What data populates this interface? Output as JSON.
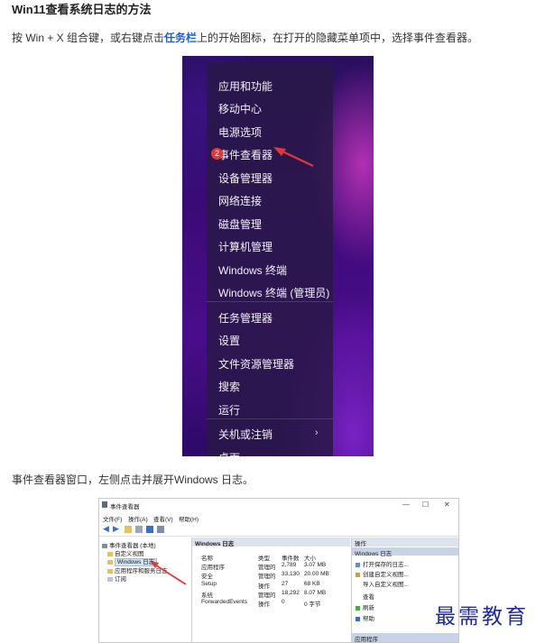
{
  "article": {
    "title": "Win11查看系统日志的方法",
    "p1_before": "按 Win + X 组合键，或右键点击",
    "p1_link": "任务栏",
    "p1_after": "上的开始图标，在打开的隐藏菜单项中，选择事件查看器。",
    "p2": "事件查看器窗口，左侧点击并展开Windows 日志。"
  },
  "winx_menu": {
    "badge": "2",
    "items": [
      "应用和功能",
      "移动中心",
      "电源选项",
      "事件查看器",
      "设备管理器",
      "网络连接",
      "磁盘管理",
      "计算机管理",
      "Windows 终端",
      "Windows 终端 (管理员)",
      "任务管理器",
      "设置",
      "文件资源管理器",
      "搜索",
      "运行",
      "关机或注销",
      "桌面"
    ],
    "submenu_arrow": "›",
    "highlight_color": "#e0383a"
  },
  "event_viewer": {
    "window_title": "事件查看器",
    "window_controls": [
      "—",
      "☐",
      "✕"
    ],
    "menu": [
      "文件(F)",
      "操作(A)",
      "查看(V)",
      "帮助(H)"
    ],
    "tree": [
      "事件查看器 (本地)",
      "自定义视图",
      "Windows 日志",
      "应用程序和服务日志",
      "订阅"
    ],
    "middle_title": "Windows 日志",
    "columns": [
      "名称",
      "类型",
      "事件数",
      "大小"
    ],
    "rows": [
      [
        "应用程序",
        "管理的",
        "2,789",
        "3.07 MB"
      ],
      [
        "安全",
        "管理的",
        "33,130",
        "20.00 MB"
      ],
      [
        "Setup",
        "操作",
        "27",
        "68 KB"
      ],
      [
        "系统",
        "管理的",
        "18,292",
        "8.07 MB"
      ],
      [
        "ForwardedEvents",
        "操作",
        "0",
        "0 字节"
      ]
    ],
    "actions_title": "操作",
    "actions_sub": "Windows 日志",
    "actions": [
      "打开保存的日志...",
      "创建自定义视图...",
      "导入自定义视图...",
      "查看",
      "刷新",
      "帮助"
    ],
    "actions_footer": "应用程序"
  },
  "watermark": "最需教育"
}
